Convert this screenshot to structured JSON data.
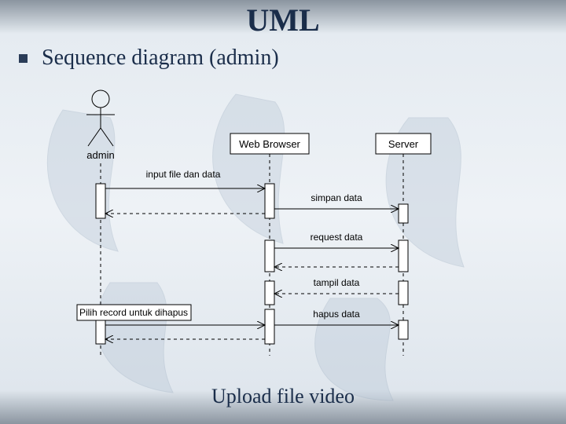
{
  "title": "UML",
  "bullet": "Sequence diagram (admin)",
  "caption": "Upload file video",
  "lifelines": {
    "admin": "admin",
    "browser": "Web Browser",
    "server": "Server"
  },
  "messages": {
    "m1": "input file dan data",
    "m2": "simpan data",
    "m3": "request data",
    "m4": "tampil data",
    "m5": "Pilih record untuk dihapus",
    "m6": "hapus data"
  }
}
